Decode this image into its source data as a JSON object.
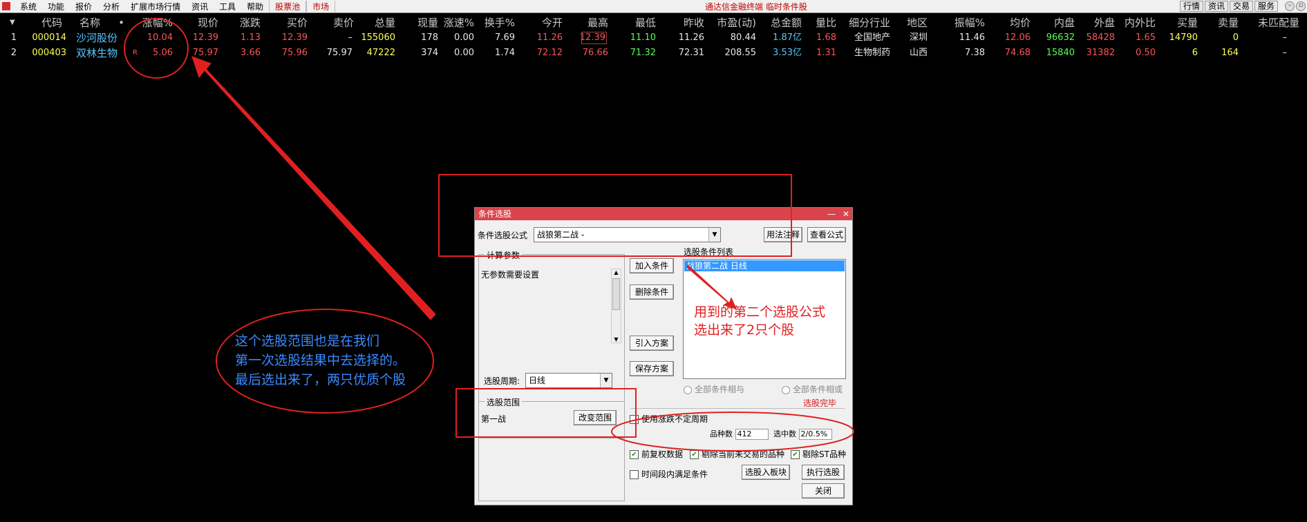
{
  "menubar": {
    "items": [
      "系统",
      "功能",
      "报价",
      "分析",
      "扩展市场行情",
      "资讯",
      "工具",
      "帮助"
    ],
    "highlighted": [
      "股票池",
      "市场"
    ],
    "title": "通达信金融终端 临时条件股",
    "right_buttons": [
      "行情",
      "资讯",
      "交易",
      "服务"
    ]
  },
  "table": {
    "headers": [
      "代码",
      "名称",
      "•",
      "涨幅%",
      "现价",
      "涨跌",
      "买价",
      "卖价",
      "总量",
      "现量",
      "涨速%",
      "换手%",
      "今开",
      "最高",
      "最低",
      "昨收",
      "市盈(动)",
      "总金额",
      "量比",
      "细分行业",
      "地区",
      "振幅%",
      "均价",
      "内盘",
      "外盘",
      "内外比",
      "买量",
      "卖量",
      "未匹配量"
    ],
    "rows": [
      {
        "idx": "1",
        "code": "000014",
        "name": "沙河股份",
        "flag": "",
        "chg_pct": "10.04",
        "price": "12.39",
        "chg": "1.13",
        "bid": "12.39",
        "ask": "–",
        "vol": "155060",
        "cur_vol": "178",
        "speed": "0.00",
        "turnover": "7.69",
        "open": "11.26",
        "high": "12.39",
        "low": "11.10",
        "prev": "11.26",
        "pe": "80.44",
        "amount": "1.87亿",
        "vol_ratio": "1.68",
        "industry": "全国地产",
        "region": "深圳",
        "amplitude": "11.46",
        "avg": "12.06",
        "inner": "96632",
        "outer": "58428",
        "io_ratio": "1.65",
        "bid_vol": "14790",
        "ask_vol": "0",
        "unmatched": "–"
      },
      {
        "idx": "2",
        "code": "000403",
        "name": "双林生物",
        "flag": "R",
        "chg_pct": "5.06",
        "price": "75.97",
        "chg": "3.66",
        "bid": "75.96",
        "ask": "75.97",
        "vol": "47222",
        "cur_vol": "374",
        "speed": "0.00",
        "turnover": "1.74",
        "open": "72.12",
        "high": "76.66",
        "low": "71.32",
        "prev": "72.31",
        "pe": "208.55",
        "amount": "3.53亿",
        "vol_ratio": "1.31",
        "industry": "生物制药",
        "region": "山西",
        "amplitude": "7.38",
        "avg": "74.68",
        "inner": "15840",
        "outer": "31382",
        "io_ratio": "0.50",
        "bid_vol": "6",
        "ask_vol": "164",
        "unmatched": "–"
      }
    ]
  },
  "dialog": {
    "title": "条件选股",
    "formula_label": "条件选股公式",
    "formula_value": "战狼第二战   -",
    "usage_btn": "用法注释",
    "view_formula_btn": "查看公式",
    "params_legend": "计算参数",
    "params_text": "无参数需要设置",
    "add_btn": "加入条件",
    "delete_btn": "删除条件",
    "import_btn": "引入方案",
    "save_btn": "保存方案",
    "cond_list_label": "选股条件列表",
    "cond_item": "战狼第二战  日线",
    "period_label": "选股周期:",
    "period_value": "日线",
    "all_and": "全部条件相与",
    "all_or": "全部条件相或",
    "scope_legend": "选股范围",
    "scope_value": "第一战",
    "change_scope_btn": "改变范围",
    "done_text": "选股完毕",
    "use_period_chk": "使用涨跌不定周期",
    "count_label": "品种数",
    "count_value": "412",
    "selected_label": "选中数",
    "selected_value": "2/0.5%",
    "prev_rights": "前复权数据",
    "exclude_untraded": "剔除当前未交易的品种",
    "exclude_st": "剔除ST品种",
    "time_satisfy": "时间段内满足条件",
    "to_block_btn": "选股入板块",
    "execute_btn": "执行选股",
    "close_btn": "关闭"
  },
  "annotations": {
    "left_text": [
      "这个选股范围也是在我们",
      "第一次选股结果中去选择的。",
      "最后选出来了，两只优质个股"
    ],
    "right_text": [
      "用到的第二个选股公式",
      "选出来了2只个股"
    ]
  },
  "colors": {
    "annotation_red": "#e02020",
    "annotation_blue": "#3a8aff",
    "dialog_title": "#d9444c"
  }
}
